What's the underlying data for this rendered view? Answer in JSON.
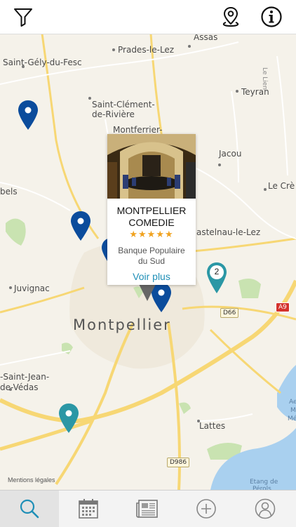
{
  "header": {
    "filter_icon": "filter-icon",
    "location_icon": "location-pin-icon",
    "info_icon": "info-icon"
  },
  "map": {
    "places": {
      "assas": "Assas",
      "prades": "Prades-le-Lez",
      "saint_gely": "Saint-Gély-du-Fesc",
      "le_lien": "Le Lien",
      "teyran": "Teyran",
      "saint_clement_1": "Saint-Clément-",
      "saint_clement_2": "de-Rivière",
      "montferrier": "Montferrier-",
      "jacou": "Jacou",
      "bels": "bels",
      "le_cre": "Le Crè",
      "castelnau": "astelnau-le-Lez",
      "juvignac": "Juvignac",
      "montpellier": "Montpellier",
      "saint_jean_1": "-Saint-Jean-",
      "saint_jean_2": "de-Védas",
      "lattes": "Lattes",
      "etang_1": "Etang de",
      "etang_2": "Pérols",
      "edge_ae": "Ae",
      "edge_m": "M",
      "edge_me": "Mé"
    },
    "roads": {
      "d66": "D66",
      "a9": "A9",
      "d986": "D986"
    },
    "cluster_count": "2",
    "legal": "Mentions légales"
  },
  "popup": {
    "title_line1": "MONTPELLIER",
    "title_line2": "COMEDIE",
    "rating": 5,
    "stars": "★★★★★",
    "bank_line1": "Banque Populaire",
    "bank_line2": "du Sud",
    "more_label": "Voir plus"
  },
  "tabs": [
    {
      "name": "search",
      "icon": "search-icon",
      "active": true
    },
    {
      "name": "calendar",
      "icon": "calendar-icon",
      "active": false
    },
    {
      "name": "news",
      "icon": "newspaper-icon",
      "active": false
    },
    {
      "name": "add",
      "icon": "add-circle-icon",
      "active": false
    },
    {
      "name": "profile",
      "icon": "user-icon",
      "active": false
    }
  ],
  "colors": {
    "pin_dark_blue": "#0b4c9c",
    "pin_teal": "#2b97a5",
    "accent_blue": "#1f8fb7",
    "star_orange": "#f0a21f",
    "road_yellow": "#f7d774",
    "water_blue": "#a9d0ef",
    "park_green": "#c9e3b1"
  }
}
